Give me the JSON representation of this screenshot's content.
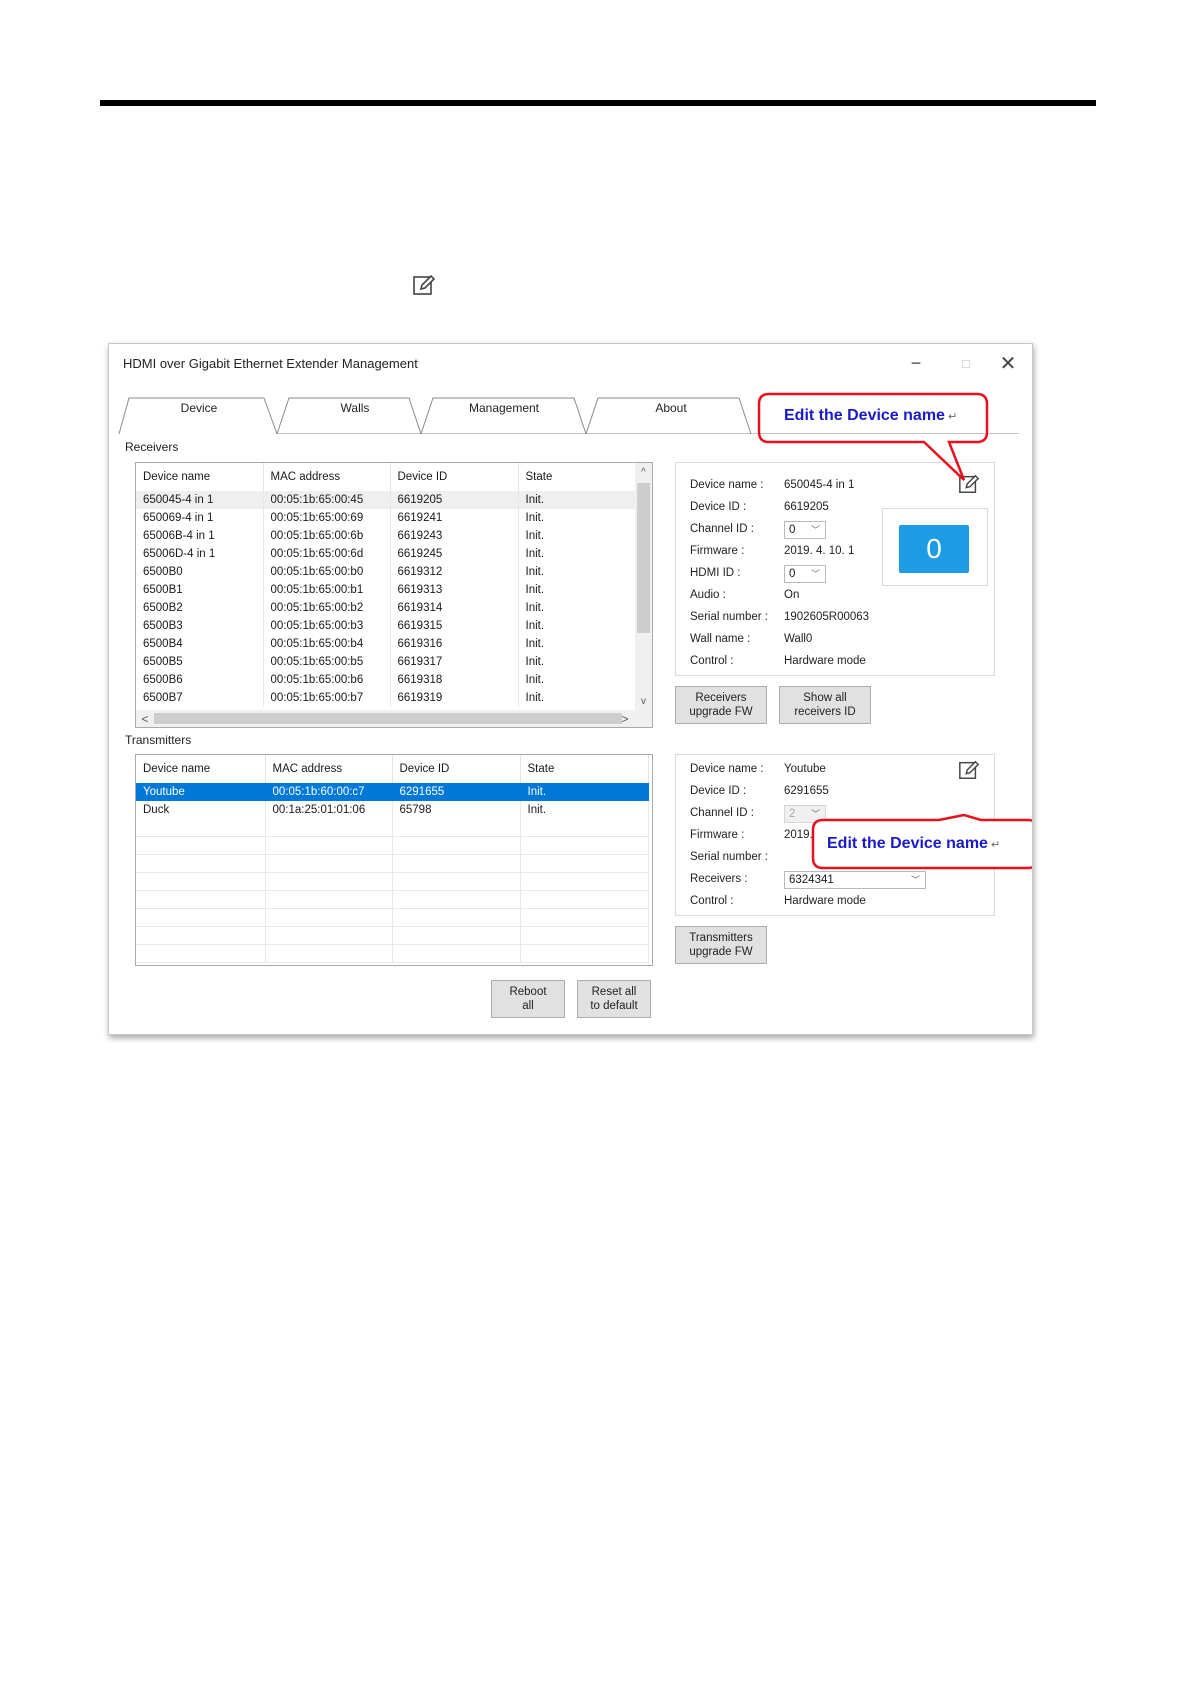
{
  "window": {
    "title": "HDMI over Gigabit Ethernet Extender Management",
    "controls": {
      "minimize": "−",
      "maximize": "□",
      "close": "✕"
    }
  },
  "tabs": [
    {
      "label": "Device"
    },
    {
      "label": "Walls"
    },
    {
      "label": "Management"
    },
    {
      "label": "About"
    }
  ],
  "receivers": {
    "section_label": "Receivers",
    "columns": [
      "Device name",
      "MAC address",
      "Device ID",
      "State"
    ],
    "rows": [
      [
        "650045-4 in 1",
        "00:05:1b:65:00:45",
        "6619205",
        "Init."
      ],
      [
        "650069-4 in 1",
        "00:05:1b:65:00:69",
        "6619241",
        "Init."
      ],
      [
        "65006B-4 in 1",
        "00:05:1b:65:00:6b",
        "6619243",
        "Init."
      ],
      [
        "65006D-4 in 1",
        "00:05:1b:65:00:6d",
        "6619245",
        "Init."
      ],
      [
        "6500B0",
        "00:05:1b:65:00:b0",
        "6619312",
        "Init."
      ],
      [
        "6500B1",
        "00:05:1b:65:00:b1",
        "6619313",
        "Init."
      ],
      [
        "6500B2",
        "00:05:1b:65:00:b2",
        "6619314",
        "Init."
      ],
      [
        "6500B3",
        "00:05:1b:65:00:b3",
        "6619315",
        "Init."
      ],
      [
        "6500B4",
        "00:05:1b:65:00:b4",
        "6619316",
        "Init."
      ],
      [
        "6500B5",
        "00:05:1b:65:00:b5",
        "6619317",
        "Init."
      ],
      [
        "6500B6",
        "00:05:1b:65:00:b6",
        "6619318",
        "Init."
      ],
      [
        "6500B7",
        "00:05:1b:65:00:b7",
        "6619319",
        "Init."
      ]
    ],
    "scroll_up": "^",
    "scroll_down": "v",
    "scroll_left": "<",
    "scroll_right": ">"
  },
  "receiver_detail": {
    "labels": {
      "device_name": "Device name :",
      "device_id": "Device ID :",
      "channel_id": "Channel ID :",
      "firmware": "Firmware :",
      "hdmi_id": "HDMI ID :",
      "audio": "Audio :",
      "serial_number": "Serial number :",
      "wall_name": "Wall name :",
      "control": "Control :"
    },
    "values": {
      "device_name": "650045-4 in 1",
      "device_id": "6619205",
      "channel_id": "0",
      "firmware": "2019. 4. 10. 1",
      "hdmi_id": "0",
      "audio": "On",
      "serial_number": "1902605R00063",
      "wall_name": "Wall0",
      "control": "Hardware mode"
    },
    "channel_display": "0",
    "buttons": {
      "upgrade_line1": "Receivers",
      "upgrade_line2": "upgrade FW",
      "show_line1": "Show all",
      "show_line2": "receivers ID"
    }
  },
  "transmitters": {
    "section_label": "Transmitters",
    "columns": [
      "Device name",
      "MAC address",
      "Device ID",
      "State"
    ],
    "rows": [
      [
        "Youtube",
        "00:05:1b:60:00:c7",
        "6291655",
        "Init."
      ],
      [
        "Duck",
        "00:1a:25:01:01:06",
        "65798",
        "Init."
      ]
    ],
    "selected_row": 0
  },
  "transmitter_detail": {
    "labels": {
      "device_name": "Device name :",
      "device_id": "Device ID :",
      "channel_id": "Channel ID :",
      "firmware": "Firmware :",
      "serial_number": "Serial number :",
      "receivers": "Receivers :",
      "control": "Control :"
    },
    "values": {
      "device_name": "Youtube",
      "device_id": "6291655",
      "channel_id": "2",
      "firmware": "2019. 4. 11. 1",
      "receivers": "6324341",
      "control": "Hardware mode"
    },
    "buttons": {
      "upgrade_line1": "Transmitters",
      "upgrade_line2": "upgrade FW"
    }
  },
  "bottom_buttons": {
    "reboot_line1": "Reboot",
    "reboot_line2": "all",
    "reset_line1": "Reset all",
    "reset_line2": "to default"
  },
  "callouts": {
    "receiver": "Edit the Device name",
    "transmitter": "Edit the Device name",
    "return_mark": "↵"
  },
  "colors": {
    "selection": "#0078d7",
    "channel_badge": "#1c9ce5",
    "callout_border": "#e8101e",
    "callout_text": "#1a1ac8"
  },
  "icons": [
    "edit-icon",
    "minimize-icon",
    "maximize-icon",
    "close-icon"
  ]
}
